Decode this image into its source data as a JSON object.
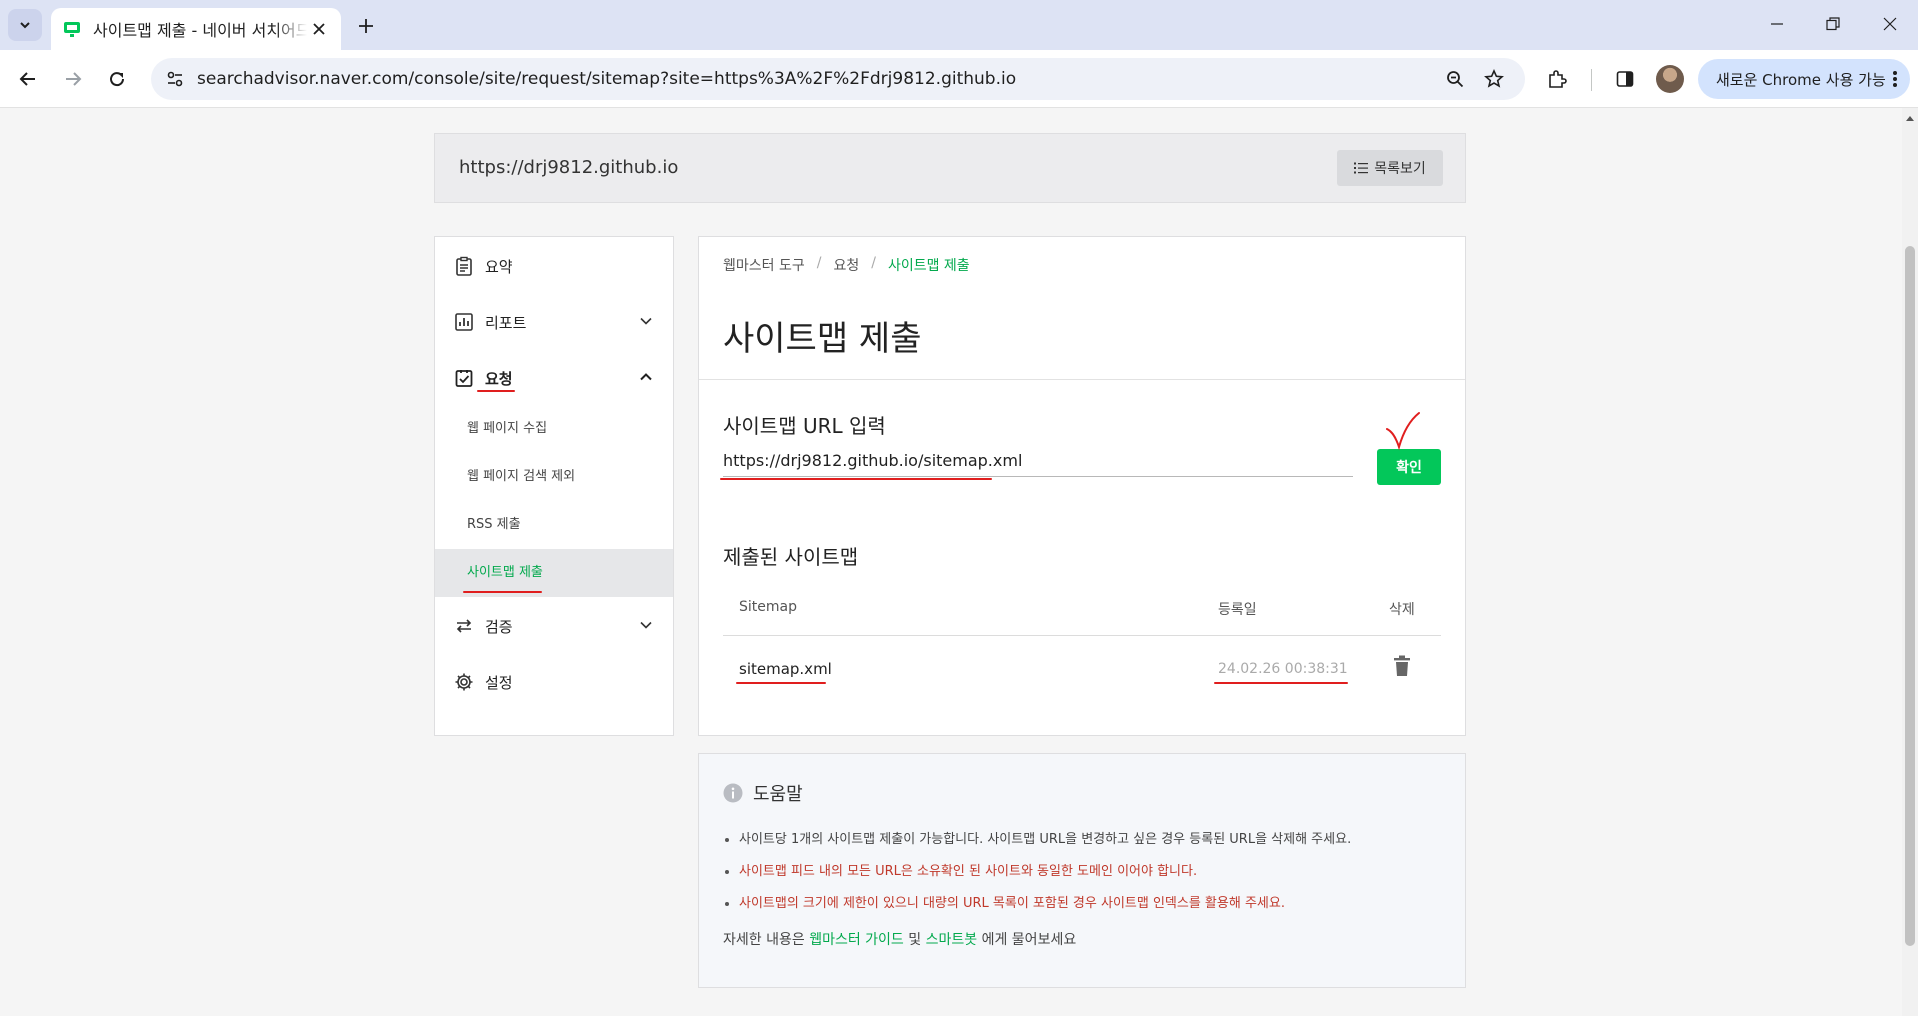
{
  "browser": {
    "tab_title": "사이트맵 제출 - 네이버 서치어드바이저",
    "url": "searchadvisor.naver.com/console/site/request/sitemap?site=https%3A%2F%2Fdrj9812.github.io",
    "update_button": "새로운 Chrome 사용 가능"
  },
  "site": {
    "url": "https://drj9812.github.io",
    "list_button": "목록보기"
  },
  "sidebar": {
    "summary": "요약",
    "report": "리포트",
    "request": "요청",
    "request_items": [
      "웹 페이지 수집",
      "웹 페이지 검색 제외",
      "RSS 제출",
      "사이트맵 제출"
    ],
    "verify": "검증",
    "settings": "설정"
  },
  "breadcrumb": [
    "웹마스터 도구",
    "요청",
    "사이트맵 제출"
  ],
  "main": {
    "title": "사이트맵 제출",
    "input_label": "사이트맵 URL 입력",
    "input_value": "https://drj9812.github.io/sitemap.xml",
    "confirm_button": "확인",
    "submitted_label": "제출된 사이트맵"
  },
  "table": {
    "headers": [
      "Sitemap",
      "등록일",
      "삭제"
    ],
    "rows": [
      {
        "sitemap": "sitemap.xml",
        "date": "24.02.26 00:38:31"
      }
    ]
  },
  "help": {
    "title": "도움말",
    "items": [
      "사이트당 1개의 사이트맵 제출이 가능합니다. 사이트맵 URL을 변경하고 싶은 경우 등록된 URL을 삭제해 주세요.",
      "사이트맵 피드 내의 모든 URL은 소유확인 된 사이트와 동일한 도메인 이어야 합니다.",
      "사이트맵의 크기에 제한이 있으니 대량의 URL 목록이 포함된 경우 사이트맵 인덱스를 활용해 주세요."
    ],
    "more_prefix": "자세한 내용은",
    "link_guide": "웹마스터 가이드",
    "and": "및",
    "link_bot": "스마트봇",
    "more_suffix": "에게 물어보세요"
  },
  "colors": {
    "accent": "#03c75a",
    "annotation": "#e01e1e"
  }
}
